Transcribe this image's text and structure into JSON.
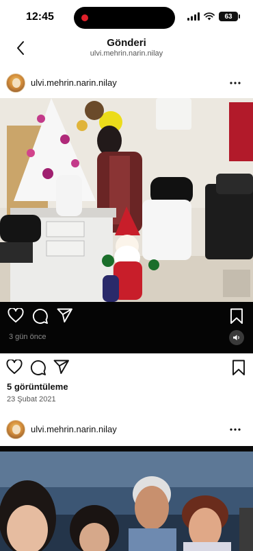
{
  "status_bar": {
    "time": "12:45",
    "battery": "63"
  },
  "header": {
    "title": "Gönderi",
    "subtitle": "ulvi.mehrin.narin.nilay"
  },
  "post1": {
    "username": "ulvi.mehrin.narin.nilay",
    "video_relative_date": "3 gün önce",
    "views": "5 görüntüleme",
    "date": "23 Şubat 2021"
  },
  "post2": {
    "username": "ulvi.mehrin.narin.nilay"
  },
  "icons": {
    "back": "chevron-left-icon",
    "more": "more-horizontal-icon",
    "like": "heart-icon",
    "comment": "comment-icon",
    "share": "send-icon",
    "save": "bookmark-icon",
    "mute": "speaker-icon"
  }
}
